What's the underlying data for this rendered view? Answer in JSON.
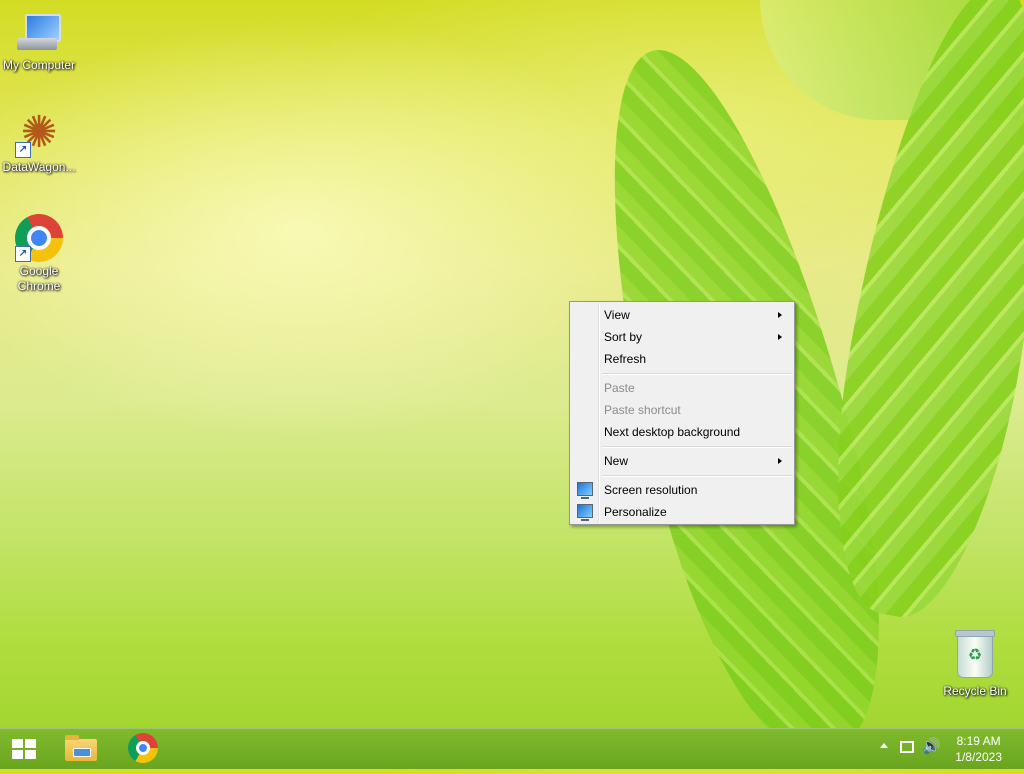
{
  "desktop": {
    "icons": [
      {
        "label": "My Computer",
        "icon": "computer-icon"
      },
      {
        "label": "DataWagon...",
        "icon": "datawagon-icon"
      },
      {
        "label": "Google Chrome",
        "label_line1": "Google",
        "label_line2": "Chrome",
        "icon": "chrome-icon"
      },
      {
        "label": "Recycle Bin",
        "icon": "recycle-bin-icon"
      }
    ]
  },
  "context_menu": {
    "items": [
      {
        "label": "View",
        "submenu": true,
        "enabled": true
      },
      {
        "label": "Sort by",
        "submenu": true,
        "enabled": true
      },
      {
        "label": "Refresh",
        "enabled": true
      },
      {
        "label": "Paste",
        "enabled": false
      },
      {
        "label": "Paste shortcut",
        "enabled": false
      },
      {
        "label": "Next desktop background",
        "enabled": true
      },
      {
        "label": "New",
        "submenu": true,
        "enabled": true
      },
      {
        "label": "Screen resolution",
        "icon": "monitor-icon",
        "enabled": true
      },
      {
        "label": "Personalize",
        "icon": "monitor-icon",
        "enabled": true
      }
    ]
  },
  "taskbar": {
    "pinned": [
      "File Explorer",
      "Google Chrome"
    ],
    "clock": {
      "time": "8:19 AM",
      "date": "1/8/2023"
    }
  },
  "colors": {
    "taskbar": "#74b026",
    "menu_bg": "#f0f0f0",
    "disabled_text": "#8b8b8b"
  }
}
